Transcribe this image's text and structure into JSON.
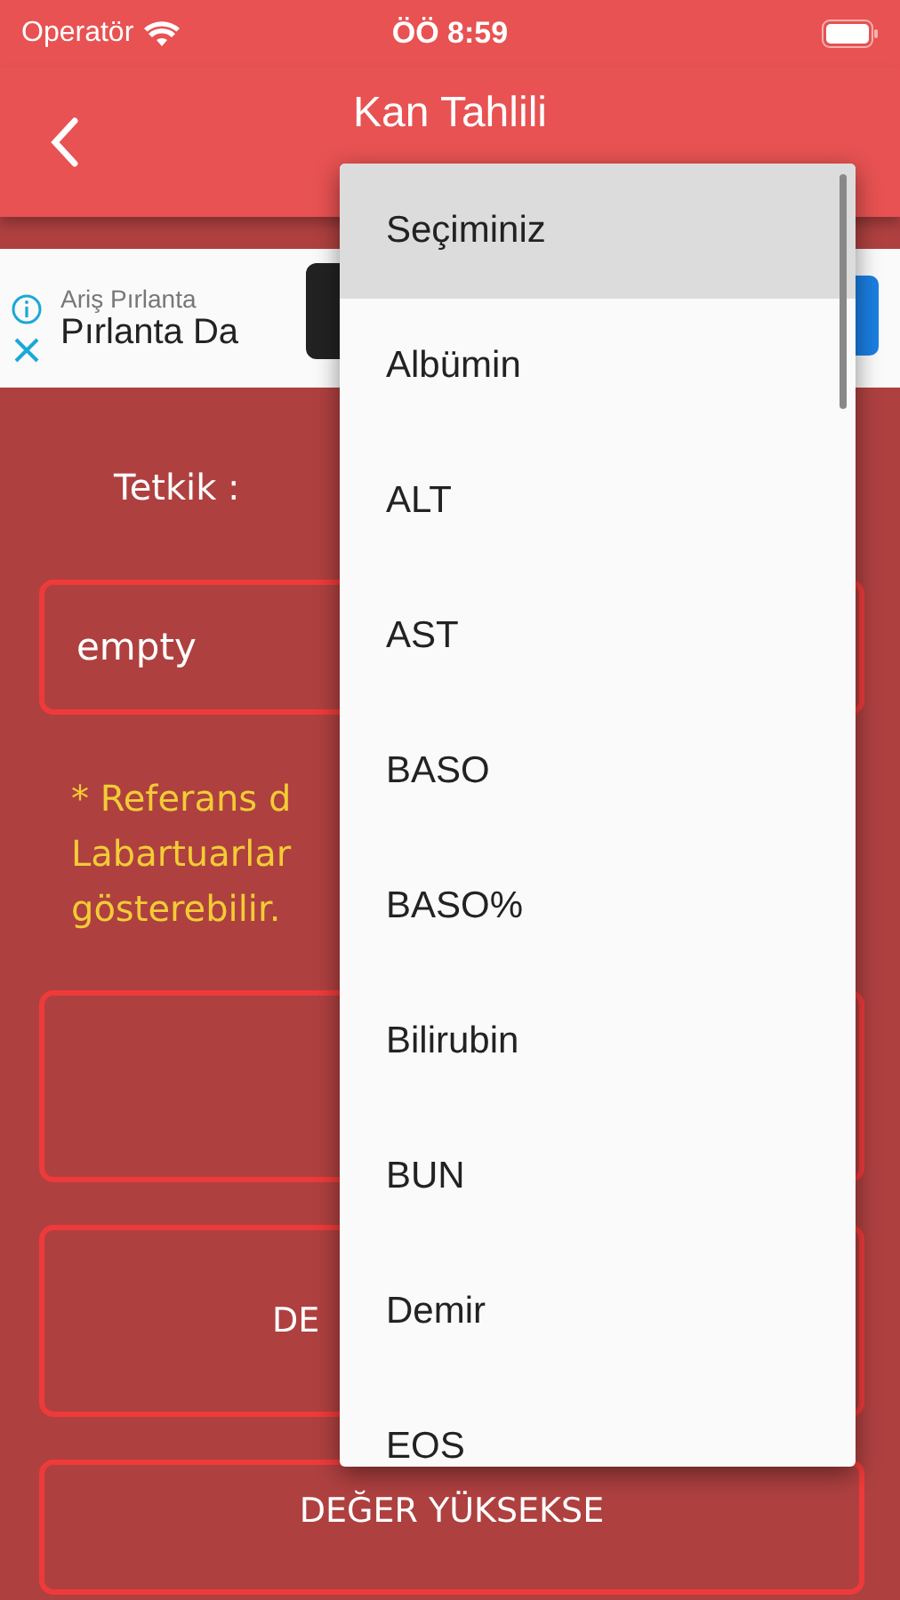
{
  "status_bar": {
    "carrier": "Operatör",
    "time": "ÖÖ 8:59"
  },
  "header": {
    "title": "Kan Tahlili"
  },
  "ad": {
    "advertiser": "Ariş Pırlanta",
    "headline": "Pırlanta Da"
  },
  "form": {
    "label": "Tetkik :",
    "field_value": "empty",
    "note_lines": [
      "* Referans d",
      "Labartuarlar",
      "gösterebilir."
    ],
    "buttons": [
      {
        "kind": "blank"
      },
      {
        "kind": "labeled",
        "label": "DE"
      },
      {
        "kind": "labeled",
        "label": "DEĞER YÜKSEKSE"
      }
    ]
  },
  "dropdown": {
    "options": [
      {
        "label": "Seçiminiz",
        "selected": true
      },
      {
        "label": "Albümin",
        "selected": false
      },
      {
        "label": "ALT",
        "selected": false
      },
      {
        "label": "AST",
        "selected": false
      },
      {
        "label": "BASO",
        "selected": false
      },
      {
        "label": "BASO%",
        "selected": false
      },
      {
        "label": "Bilirubin",
        "selected": false
      },
      {
        "label": "BUN",
        "selected": false
      },
      {
        "label": "Demir",
        "selected": false
      },
      {
        "label": "EOS",
        "selected": false
      }
    ]
  }
}
